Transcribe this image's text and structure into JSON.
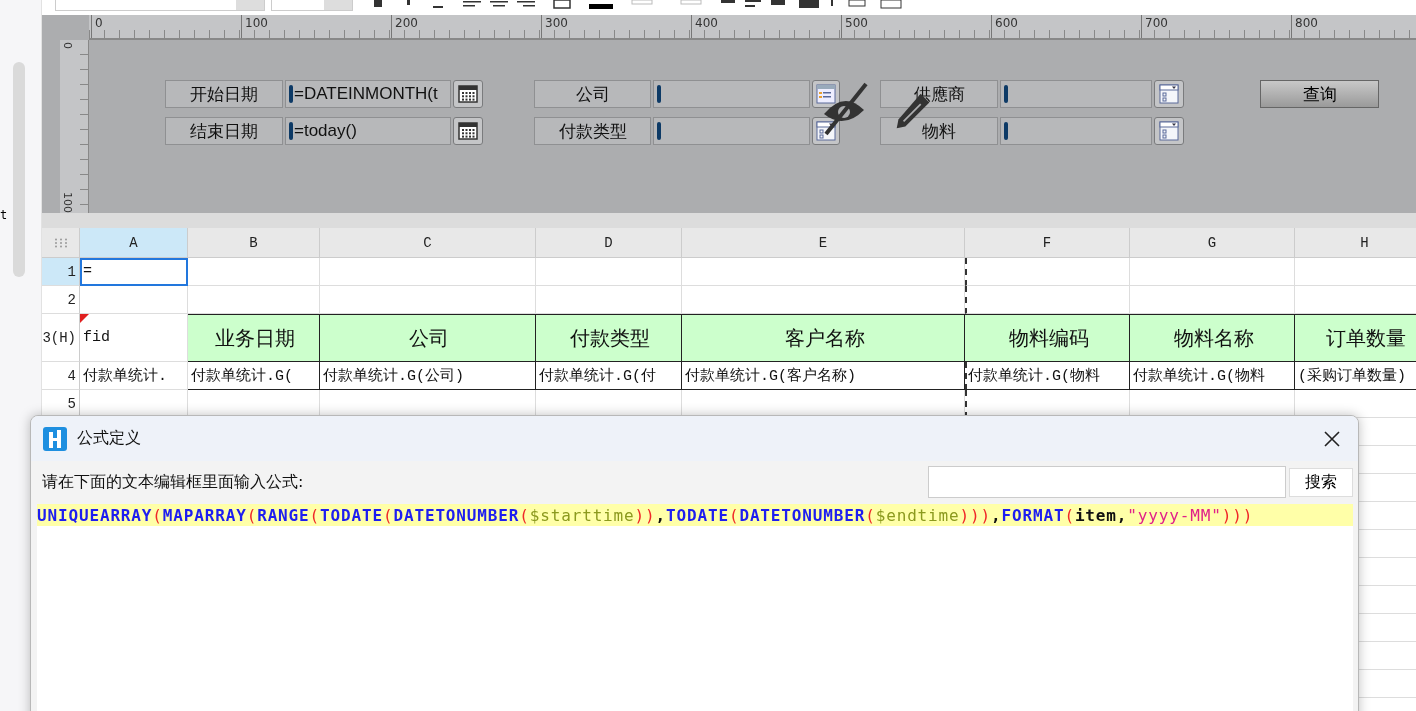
{
  "left_panel": {
    "text": "t"
  },
  "ruler": {
    "h_labels": [
      "0",
      "100",
      "200",
      "300",
      "400",
      "500",
      "600",
      "700",
      "800"
    ],
    "v_labels": [
      "0",
      "100"
    ]
  },
  "parameter_groups": [
    {
      "items": [
        {
          "label": "开始日期",
          "value": "=DATEINMONTH(t",
          "kind": "date"
        },
        {
          "label": "结束日期",
          "value": "=today()",
          "kind": "date"
        }
      ]
    },
    {
      "items": [
        {
          "label": "公司",
          "kind": "tree"
        },
        {
          "label": "付款类型",
          "kind": "dropdown"
        }
      ]
    },
    {
      "items": [
        {
          "label": "供應商",
          "kind": "dropdown"
        },
        {
          "label": "物料",
          "kind": "dropdown"
        }
      ]
    }
  ],
  "query_button": "查询",
  "sheet": {
    "columns": [
      {
        "letter": "A",
        "selected": true
      },
      {
        "letter": "B",
        "selected": false
      },
      {
        "letter": "C",
        "selected": false
      },
      {
        "letter": "D",
        "selected": false
      },
      {
        "letter": "E",
        "selected": false
      },
      {
        "letter": "F",
        "selected": false
      },
      {
        "letter": "G",
        "selected": false
      },
      {
        "letter": "H",
        "selected": false
      }
    ],
    "rows": [
      {
        "label": "1",
        "selected": true,
        "kind": "plain",
        "cells": [
          {
            "text": "=",
            "selected": true,
            "flag": false
          },
          {
            "selected": false,
            "flag": false
          },
          {
            "selected": false,
            "flag": false
          },
          {
            "selected": false,
            "flag": false
          },
          {
            "selected": false,
            "flag": false
          },
          {
            "selected": false,
            "flag": false
          },
          {
            "selected": false,
            "flag": false
          },
          {
            "selected": false,
            "flag": false
          }
        ]
      },
      {
        "label": "2",
        "selected": false,
        "kind": "plain",
        "cells": [
          {
            "selected": false,
            "flag": false
          },
          {
            "selected": false,
            "flag": false
          },
          {
            "selected": false,
            "flag": false
          },
          {
            "selected": false,
            "flag": false
          },
          {
            "selected": false,
            "flag": false
          },
          {
            "selected": false,
            "flag": false
          },
          {
            "selected": false,
            "flag": false
          },
          {
            "selected": false,
            "flag": false
          }
        ]
      },
      {
        "label": "3(H)",
        "selected": false,
        "kind": "header",
        "cells": [
          {
            "text": "fid",
            "selected": false,
            "flag": true
          },
          {
            "text": "业务日期",
            "selected": false,
            "flag": false
          },
          {
            "text": "公司",
            "selected": false,
            "flag": false
          },
          {
            "text": "付款类型",
            "selected": false,
            "flag": false
          },
          {
            "text": "客户名称",
            "selected": false,
            "flag": false
          },
          {
            "text": "物料编码",
            "selected": false,
            "flag": false
          },
          {
            "text": "物料名称",
            "selected": false,
            "flag": false
          },
          {
            "text": "订单数量",
            "selected": false,
            "flag": false
          }
        ]
      },
      {
        "label": "4",
        "selected": false,
        "kind": "data",
        "cells": [
          {
            "text": "付款单统计.",
            "selected": false,
            "flag": false
          },
          {
            "text": "付款单统计.G(",
            "selected": false,
            "flag": false
          },
          {
            "text": "付款单统计.G(公司)",
            "selected": false,
            "flag": false
          },
          {
            "text": "付款单统计.G(付",
            "selected": false,
            "flag": false
          },
          {
            "text": "付款单统计.G(客户名称)",
            "selected": false,
            "flag": false
          },
          {
            "text": "付款单统计.G(物料",
            "selected": false,
            "flag": false
          },
          {
            "text": "付款单统计.G(物料",
            "selected": false,
            "flag": false
          },
          {
            "text": "(采购订单数量)",
            "selected": false,
            "flag": false
          }
        ]
      },
      {
        "label": "5",
        "selected": false,
        "kind": "plain",
        "cells": [
          {
            "selected": false,
            "flag": false
          },
          {
            "selected": false,
            "flag": false
          },
          {
            "selected": false,
            "flag": false
          },
          {
            "selected": false,
            "flag": false
          },
          {
            "selected": false,
            "flag": false
          },
          {
            "selected": false,
            "flag": false
          },
          {
            "selected": false,
            "flag": false
          },
          {
            "selected": false,
            "flag": false
          }
        ]
      }
    ]
  },
  "dialog": {
    "title": "公式定义",
    "prompt": "请在下面的文本编辑框里面输入公式:",
    "search_button": "搜索",
    "formula": [
      {
        "text": "UNIQUEARRAY",
        "kind": "func"
      },
      {
        "text": "(",
        "kind": "paren"
      },
      {
        "text": "MAPARRAY",
        "kind": "func"
      },
      {
        "text": "(",
        "kind": "paren"
      },
      {
        "text": "RANGE",
        "kind": "func"
      },
      {
        "text": "(",
        "kind": "paren"
      },
      {
        "text": "TODATE",
        "kind": "func"
      },
      {
        "text": "(",
        "kind": "paren"
      },
      {
        "text": "DATETONUMBER",
        "kind": "func"
      },
      {
        "text": "(",
        "kind": "paren"
      },
      {
        "text": "$starttime",
        "kind": "var"
      },
      {
        "text": "))",
        "kind": "paren"
      },
      {
        "text": ",",
        "kind": "plain"
      },
      {
        "text": "TODATE",
        "kind": "func"
      },
      {
        "text": "(",
        "kind": "paren"
      },
      {
        "text": "DATETONUMBER",
        "kind": "func"
      },
      {
        "text": "(",
        "kind": "paren"
      },
      {
        "text": "$endtime",
        "kind": "var"
      },
      {
        "text": ")))",
        "kind": "paren"
      },
      {
        "text": ",",
        "kind": "plain"
      },
      {
        "text": "FORMAT",
        "kind": "func"
      },
      {
        "text": "(",
        "kind": "paren"
      },
      {
        "text": "item,",
        "kind": "plain"
      },
      {
        "text": "\"yyyy-MM\"",
        "kind": "string"
      },
      {
        "text": ")))",
        "kind": "paren"
      }
    ]
  }
}
